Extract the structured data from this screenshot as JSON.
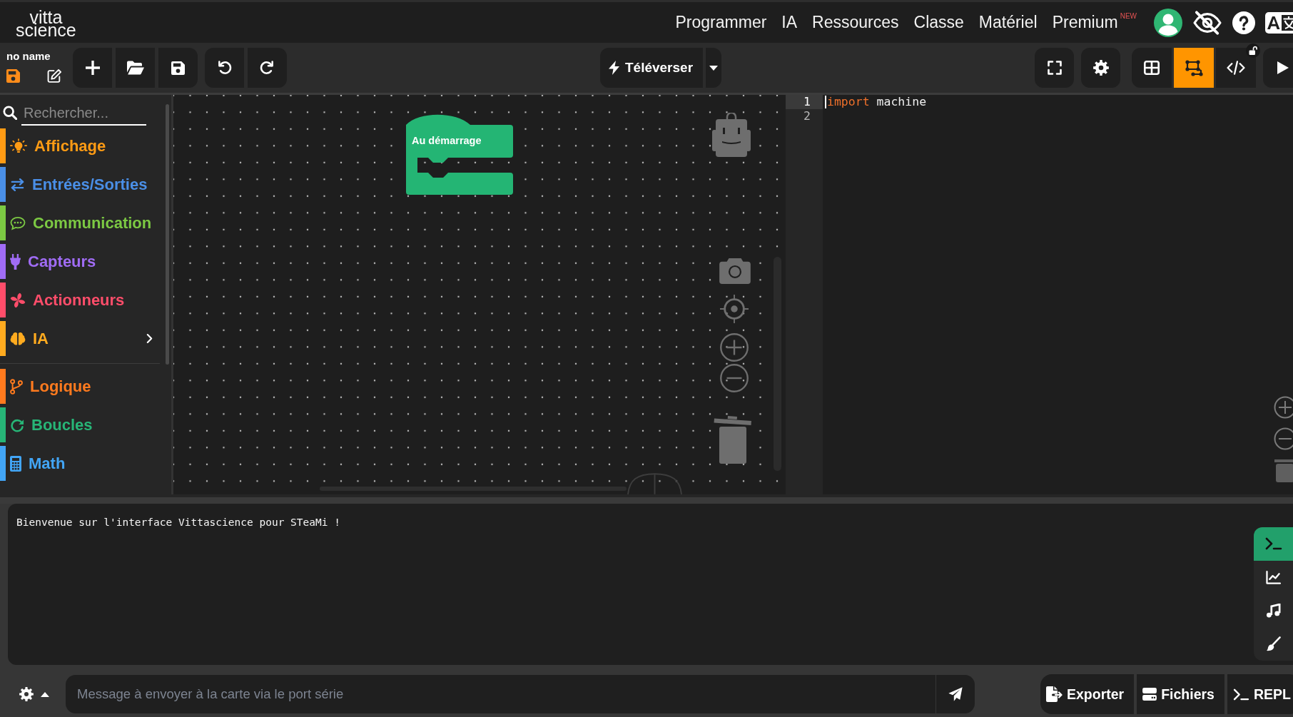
{
  "header": {
    "logo": [
      "vitta",
      "science"
    ],
    "nav": [
      {
        "label": "Programmer"
      },
      {
        "label": "IA"
      },
      {
        "label": "Ressources"
      },
      {
        "label": "Classe"
      },
      {
        "label": "Matériel"
      },
      {
        "label": "Premium",
        "badge": "NEW"
      }
    ]
  },
  "toolbar": {
    "project_name": "no name",
    "upload_button": "Téléverser",
    "view_modes": [
      {
        "kind": "grid",
        "selected": false
      },
      {
        "kind": "blocks",
        "selected": true
      },
      {
        "kind": "code",
        "selected": false
      }
    ]
  },
  "sidebar": {
    "search": {
      "placeholder": "Rechercher..."
    },
    "sections": [
      {
        "categories": [
          {
            "kind": "display",
            "label": "Affichage",
            "color": "#ff9b14",
            "submenu": false
          },
          {
            "kind": "io",
            "label": "Entrées/Sorties",
            "color": "#4a8fe7",
            "submenu": false
          },
          {
            "kind": "communication",
            "label": "Communication",
            "color": "#7cc943",
            "submenu": false
          },
          {
            "kind": "sensors",
            "label": "Capteurs",
            "color": "#a06cf5",
            "submenu": false
          },
          {
            "kind": "actuators",
            "label": "Actionneurs",
            "color": "#ff4d6a",
            "submenu": false
          },
          {
            "kind": "ai",
            "label": "IA",
            "color": "#ffab1f",
            "submenu": true
          }
        ]
      },
      {
        "categories": [
          {
            "kind": "logic",
            "label": "Logique",
            "color": "#ff7a1e",
            "submenu": false
          },
          {
            "kind": "loops",
            "label": "Boucles",
            "color": "#27b577",
            "submenu": false
          },
          {
            "kind": "math",
            "label": "Math",
            "color": "#42a5f5",
            "submenu": false
          }
        ]
      }
    ]
  },
  "workspace": {
    "blocks": [
      {
        "label": "Au démarrage"
      }
    ]
  },
  "editor": {
    "lines": [
      {
        "number": "1",
        "cursor": true,
        "tokens": [
          {
            "kind": "keyword",
            "text": "import"
          },
          {
            "kind": "name",
            "text": "machine"
          }
        ]
      },
      {
        "number": "2",
        "cursor": false
      }
    ]
  },
  "console": {
    "output": [
      "Bienvenue sur l'interface Vittascience pour STeaMi !"
    ],
    "tabs": [
      {
        "kind": "terminal",
        "selected": true
      },
      {
        "kind": "chart",
        "selected": false
      },
      {
        "kind": "music",
        "selected": false
      },
      {
        "kind": "brush",
        "selected": false
      }
    ],
    "message_input": {
      "placeholder": "Message à envoyer à la carte via le port série"
    },
    "actions": [
      {
        "kind": "export",
        "label": "Exporter"
      },
      {
        "kind": "files",
        "label": "Fichiers"
      },
      {
        "kind": "repl",
        "label": "REPL"
      }
    ]
  }
}
